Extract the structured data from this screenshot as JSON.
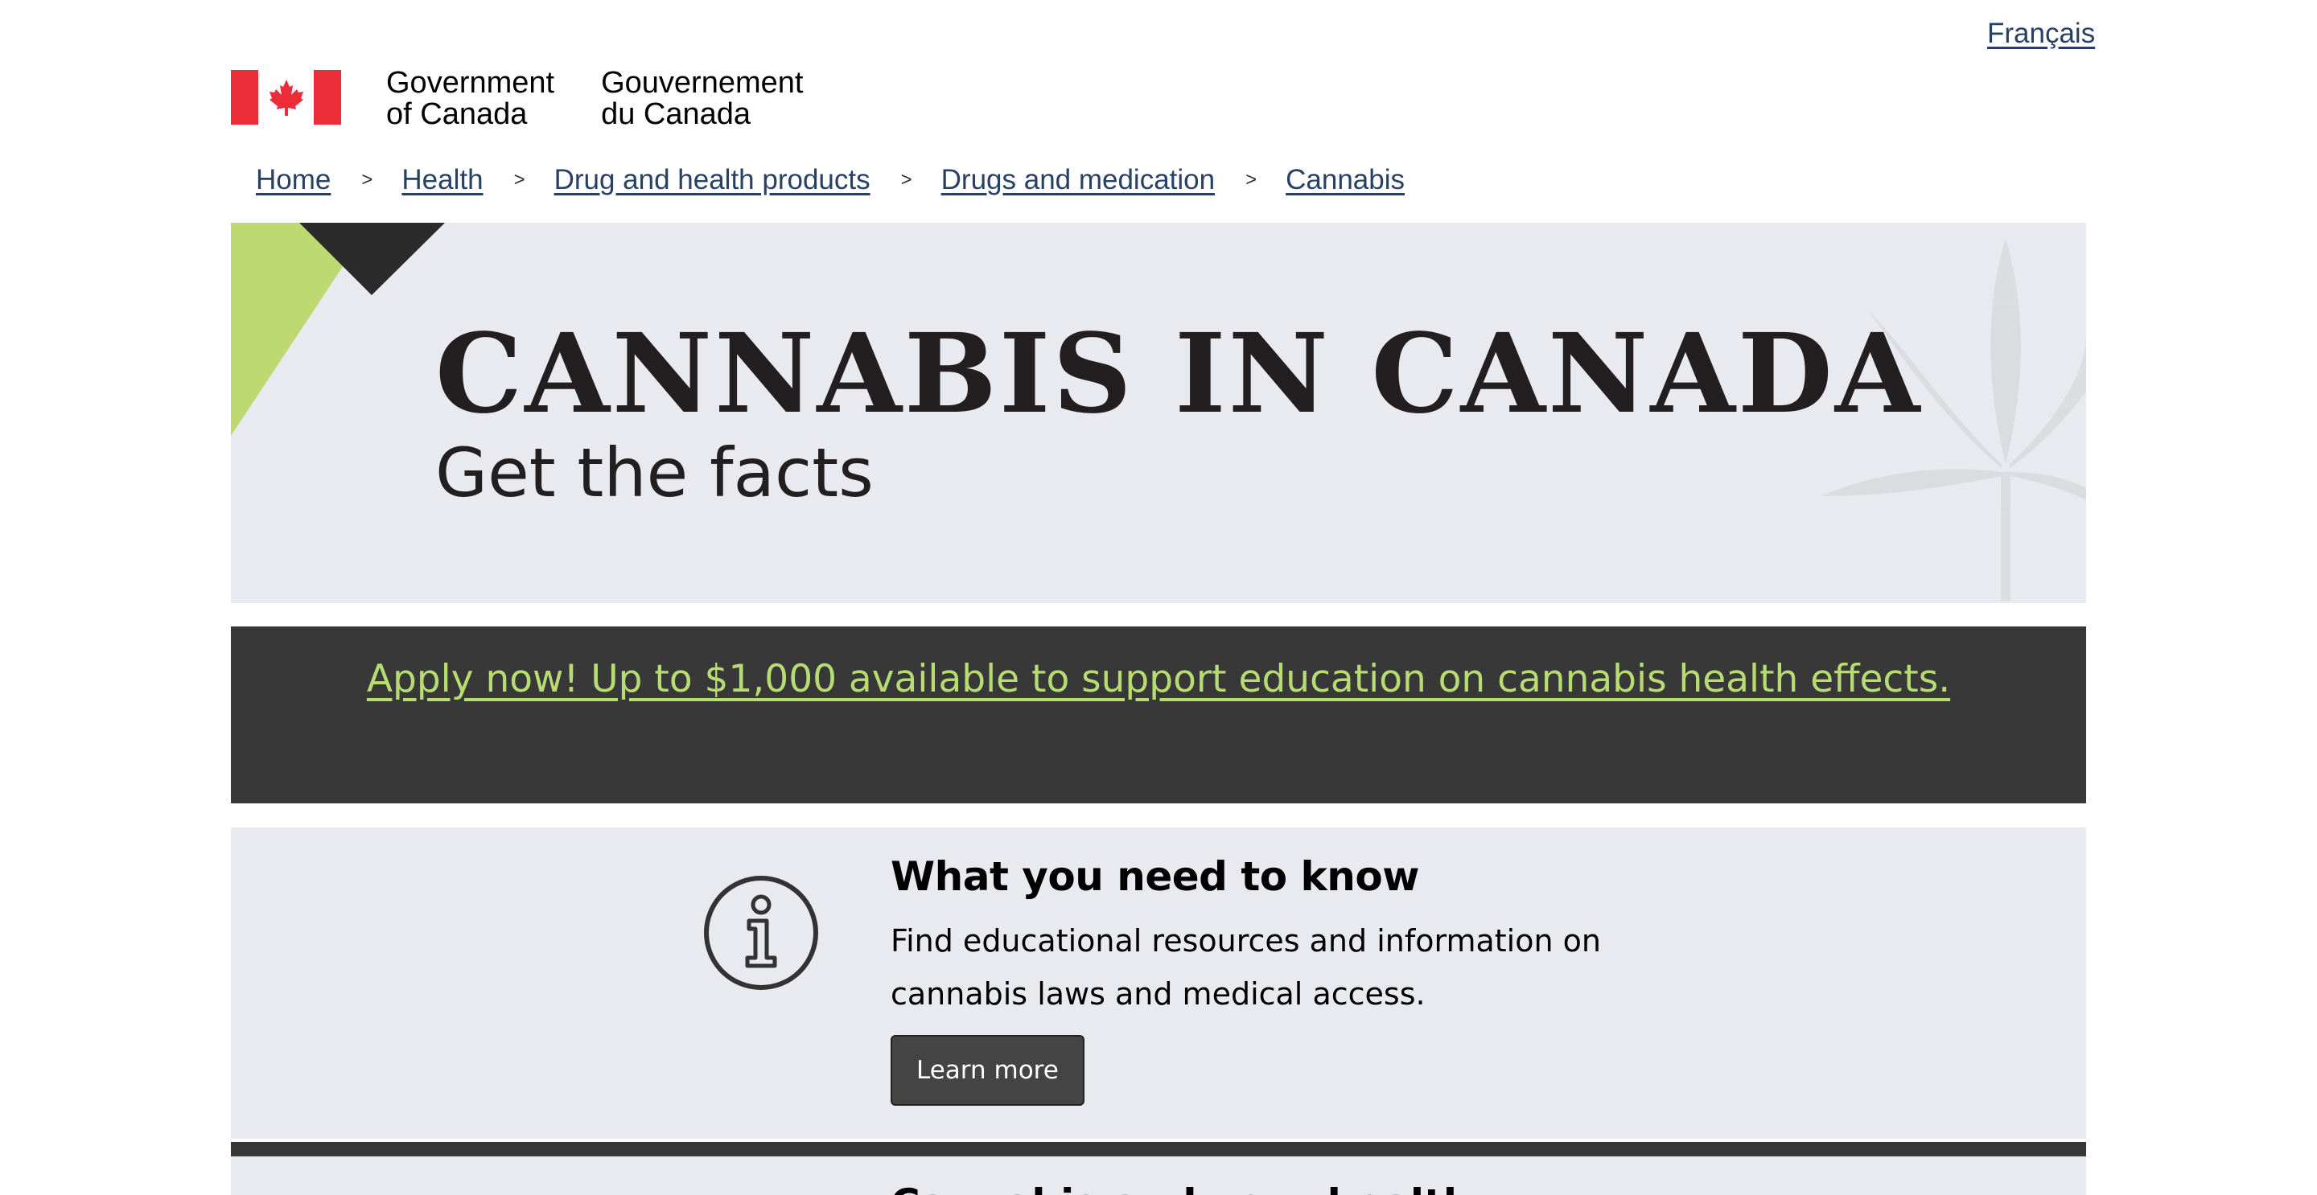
{
  "header": {
    "language_link": "Français",
    "signature_en": "Government\nof Canada",
    "signature_fr": "Gouvernement\ndu Canada"
  },
  "breadcrumb": {
    "separator": ">",
    "items": [
      "Home",
      "Health",
      "Drug and health products",
      "Drugs and medication",
      "Cannabis"
    ]
  },
  "hero": {
    "title": "CANNABIS IN CANADA",
    "subtitle": "Get the facts"
  },
  "promo": {
    "link": "Apply now! Up to $1,000 available to support education on cannabis health effects."
  },
  "cards": [
    {
      "icon": "info-icon",
      "title": "What you need to know",
      "text": "Find educational resources and information on cannabis laws and medical access.",
      "button": "Learn more"
    },
    {
      "title": "Cannabis and your health"
    }
  ],
  "colors": {
    "flag_red": "#eb2d37",
    "link": "#284162",
    "hero_bg": "#e9eaef",
    "accent_green": "#b7dd72",
    "dark": "#383838"
  }
}
